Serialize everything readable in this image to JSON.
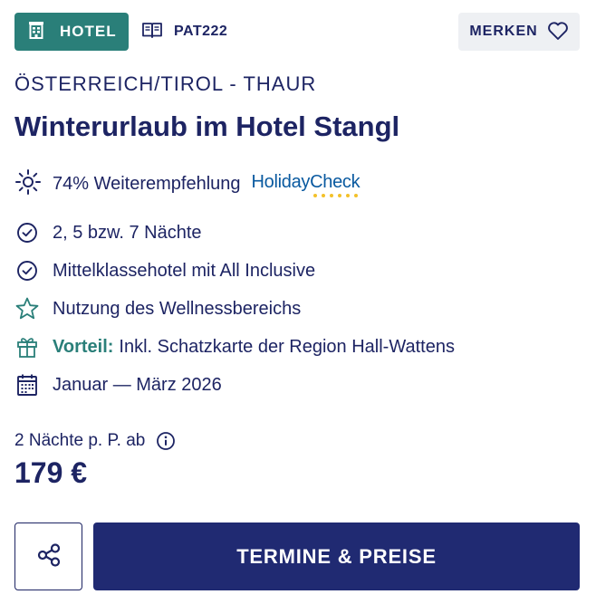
{
  "header": {
    "type_badge": {
      "label": "HOTEL",
      "icon": "building-icon"
    },
    "code": {
      "label": "PAT222",
      "icon": "open-book-icon"
    },
    "merken": {
      "label": "MERKEN",
      "icon": "heart-outline-icon"
    }
  },
  "region": "ÖSTERREICH/TIROL - THAUR",
  "title": "Winterurlaub im Hotel Stangl",
  "rating": {
    "icon": "sun-icon",
    "text": "74% Weiterempfehlung",
    "provider_prefix": "Holiday",
    "provider_suffix": "Check"
  },
  "features": [
    {
      "icon": "check-circle-icon",
      "highlight": "",
      "text": "2, 5 bzw. 7 Nächte"
    },
    {
      "icon": "check-circle-icon",
      "highlight": "",
      "text": "Mittelklassehotel mit All Inclusive"
    },
    {
      "icon": "star-outline-icon",
      "highlight": "",
      "text": "Nutzung des Wellnessbereichs"
    },
    {
      "icon": "gift-icon",
      "highlight": "Vorteil:",
      "text": "Inkl. Schatzkarte der Region Hall-Wattens"
    },
    {
      "icon": "calendar-icon",
      "highlight": "",
      "text": "Januar — März 2026"
    }
  ],
  "price": {
    "note": "2 Nächte p. P. ab",
    "note_icon": "info-icon",
    "amount": "179 €"
  },
  "actions": {
    "share_icon": "share-icon",
    "cta_label": "TERMINE & PREISE"
  },
  "colors": {
    "navy": "#1d2463",
    "teal": "#2a7f79",
    "button": "#202a72",
    "light_bg": "#eef0f3",
    "rating_dots": "#f3c12a"
  }
}
